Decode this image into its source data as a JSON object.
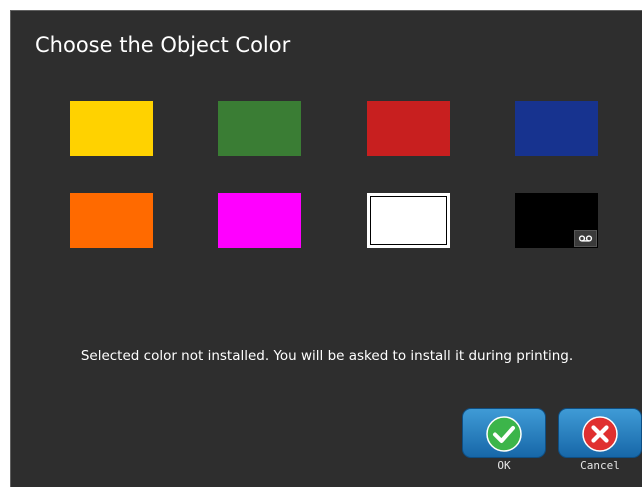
{
  "dialog": {
    "title": "Choose the Object Color",
    "message": "Selected color not installed. You will be asked to install it during printing."
  },
  "colors": [
    {
      "name": "yellow",
      "hex": "#ffd200"
    },
    {
      "name": "green",
      "hex": "#3a7d34"
    },
    {
      "name": "red",
      "hex": "#c81f1f"
    },
    {
      "name": "blue",
      "hex": "#17338f"
    },
    {
      "name": "orange",
      "hex": "#ff6a00"
    },
    {
      "name": "magenta",
      "hex": "#ff00ff"
    },
    {
      "name": "white",
      "hex": "#ffffff",
      "selected": true
    },
    {
      "name": "black",
      "hex": "#000000",
      "icon": "ribbon-cartridge-icon"
    }
  ],
  "buttons": {
    "ok": {
      "label": "OK",
      "icon": "checkmark-icon",
      "icon_color": "#3cb54a"
    },
    "cancel": {
      "label": "Cancel",
      "icon": "x-icon",
      "icon_color": "#e03030"
    }
  }
}
